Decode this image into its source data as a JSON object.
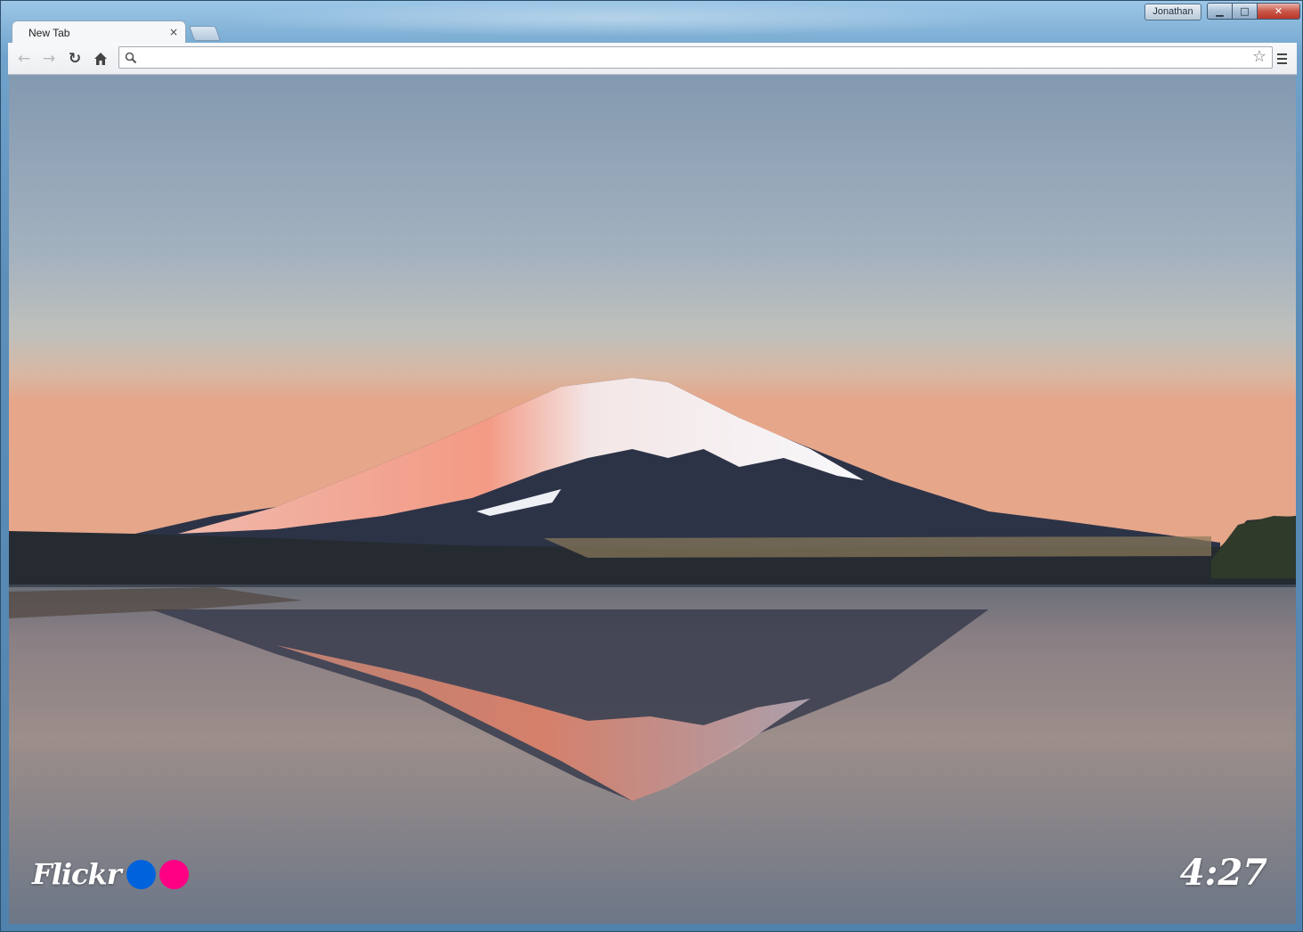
{
  "window": {
    "profile_name": "Jonathan",
    "minimize_glyph": "▁",
    "maximize_glyph": "□",
    "close_glyph": "✕"
  },
  "tabs": [
    {
      "title": "New Tab",
      "close_glyph": "×"
    }
  ],
  "toolbar": {
    "back_glyph": "←",
    "forward_glyph": "→",
    "reload_glyph": "↻",
    "home_glyph": "⌂",
    "omnibox_value": "",
    "search_glyph": "⚲",
    "star_glyph": "☆"
  },
  "new_tab_page": {
    "brand": "Flickr",
    "clock": "4:27",
    "colors": {
      "flickr_blue": "#0063dc",
      "flickr_pink": "#ff0084"
    }
  }
}
